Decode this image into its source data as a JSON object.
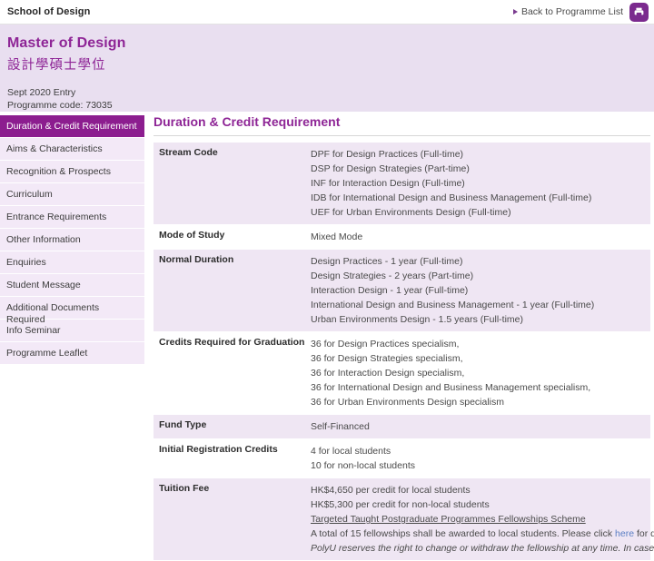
{
  "topbar": {
    "school": "School of Design",
    "back_label": "Back to Programme List",
    "back_arrow_icon": "triangle-right-icon",
    "print_icon": "print-icon"
  },
  "banner": {
    "title_en": "Master of Design",
    "title_zh": "設計學碩士學位",
    "entry": "Sept 2020 Entry",
    "code": "Programme code: 73035"
  },
  "sidebar": {
    "items": [
      {
        "label": "Duration & Credit Requirement",
        "active": true
      },
      {
        "label": "Aims & Characteristics",
        "active": false
      },
      {
        "label": "Recognition & Prospects",
        "active": false
      },
      {
        "label": "Curriculum",
        "active": false
      },
      {
        "label": "Entrance Requirements",
        "active": false
      },
      {
        "label": "Other Information",
        "active": false
      },
      {
        "label": "Enquiries",
        "active": false
      },
      {
        "label": "Student Message",
        "active": false
      },
      {
        "label": "Additional Documents Required",
        "active": false
      },
      {
        "label": "Info Seminar",
        "active": false
      },
      {
        "label": "Programme Leaflet",
        "active": false
      }
    ]
  },
  "main": {
    "section_title": "Duration & Credit Requirement",
    "rows": [
      {
        "label": "Stream Code",
        "shade": true,
        "values": [
          {
            "text": "DPF for Design Practices (Full-time)"
          },
          {
            "text": "DSP for Design Strategies (Part-time)"
          },
          {
            "text": "INF for Interaction Design (Full-time)"
          },
          {
            "text": "IDB for International Design and Business Management (Full-time)"
          },
          {
            "text": "UEF for Urban Environments Design (Full-time)"
          }
        ]
      },
      {
        "label": "Mode of Study",
        "shade": false,
        "values": [
          {
            "text": "Mixed Mode"
          }
        ]
      },
      {
        "label": "Normal Duration",
        "shade": true,
        "values": [
          {
            "text": "Design Practices - 1 year (Full-time)"
          },
          {
            "text": "Design Strategies - 2 years (Part-time)"
          },
          {
            "text": "Interaction Design - 1 year (Full-time)"
          },
          {
            "text": "International Design and Business Management - 1 year (Full-time)"
          },
          {
            "text": "Urban Environments Design - 1.5 years (Full-time)"
          }
        ]
      },
      {
        "label": "Credits Required for Graduation",
        "shade": false,
        "values": [
          {
            "text": "36 for Design Practices specialism,"
          },
          {
            "text": "36 for Design Strategies specialism,"
          },
          {
            "text": "36 for Interaction Design specialism,"
          },
          {
            "text": "36 for International Design and Business Management specialism,"
          },
          {
            "text": "36 for Urban Environments Design specialism"
          }
        ]
      },
      {
        "label": "Fund Type",
        "shade": true,
        "values": [
          {
            "text": "Self-Financed"
          }
        ]
      },
      {
        "label": "Initial Registration Credits",
        "shade": false,
        "values": [
          {
            "text": "4 for local students"
          },
          {
            "text": "10 for non-local students"
          }
        ]
      },
      {
        "label": "Tuition Fee",
        "shade": true,
        "values": [
          {
            "text": "HK$4,650 per credit for local students"
          },
          {
            "text": "HK$5,300 per credit for non-local students"
          },
          {
            "text": "Targeted Taught Postgraduate Programmes Fellowships Scheme",
            "style": "underline"
          },
          {
            "style": "rich",
            "before": "A total of 15 fellowships shall be awarded to local students. Please click ",
            "link": "here",
            "after": " for details."
          },
          {
            "text": "PolyU reserves the right to change or withdraw the fellowship at any time. In case of",
            "style": "italic"
          }
        ]
      }
    ]
  },
  "colors": {
    "brand_purple": "#8e2596",
    "active_nav": "#8c1d8f",
    "banner_bg": "#e9dff0",
    "row_shade": "#efe6f3",
    "link_blue": "#5b7fc4"
  }
}
